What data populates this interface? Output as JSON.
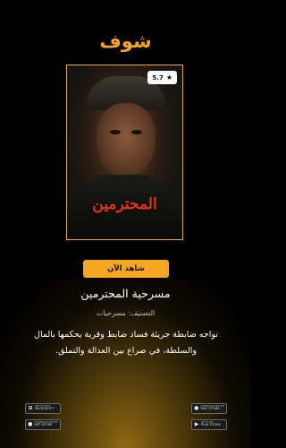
{
  "brand": {
    "logo_text": "شوف",
    "accent_color": "#f5a623"
  },
  "poster": {
    "title_text": "المحترمين",
    "rating": "5.7",
    "rating_icon": "star-icon"
  },
  "watch_button": {
    "label": "شاهد الآن"
  },
  "show": {
    "title": "مسرحية المحترمين",
    "category": "التصنيف: مسرحيات",
    "description": "تواجه ضابطة جريئة فساد ضابط وقرية يحكمها بالمال والسلطة، في صراع بين العدالة والتملق."
  },
  "stores": {
    "microsoft": {
      "small": "GET IT FROM",
      "name": "MICROSOFT",
      "icon": "windows-icon"
    },
    "mac": {
      "small": "DOWNLOAD ON THE",
      "name": "MAC STORE",
      "icon": "apple-icon"
    },
    "app_store": {
      "small": "DOWNLOAD ON THE",
      "name": "APP STORE",
      "icon": "apple-icon"
    },
    "play": {
      "small": "GET IT ON",
      "name": "PLAY STORE",
      "icon": "play-icon"
    }
  }
}
